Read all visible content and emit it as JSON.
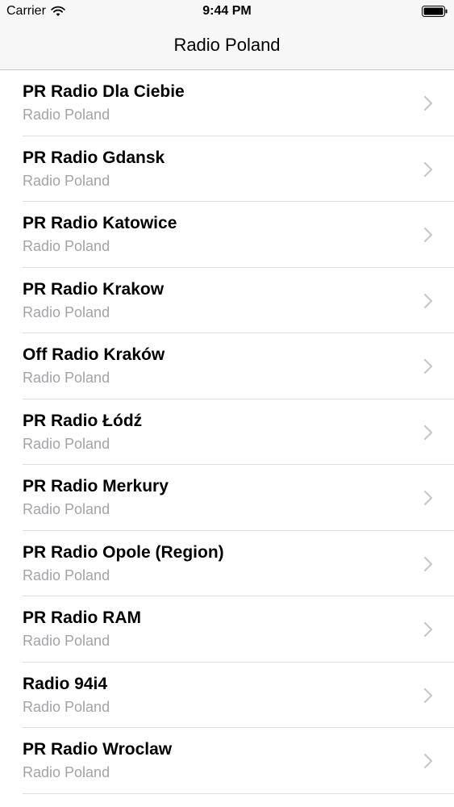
{
  "status_bar": {
    "carrier": "Carrier",
    "time": "9:44 PM",
    "icons": [
      "wifi-icon",
      "battery-icon"
    ]
  },
  "nav": {
    "title": "Radio Poland"
  },
  "stations": [
    {
      "name": "PR Radio Dla Ciebie",
      "subtitle": "Radio Poland"
    },
    {
      "name": "PR Radio Gdansk",
      "subtitle": "Radio Poland"
    },
    {
      "name": "PR Radio Katowice",
      "subtitle": "Radio Poland"
    },
    {
      "name": "PR Radio Krakow",
      "subtitle": "Radio Poland"
    },
    {
      "name": "Off Radio Kraków",
      "subtitle": "Radio Poland"
    },
    {
      "name": "PR Radio Łódź",
      "subtitle": "Radio Poland"
    },
    {
      "name": "PR Radio Merkury",
      "subtitle": "Radio Poland"
    },
    {
      "name": "PR Radio Opole (Region)",
      "subtitle": "Radio Poland"
    },
    {
      "name": "PR Radio RAM",
      "subtitle": "Radio Poland"
    },
    {
      "name": "Radio 94i4",
      "subtitle": "Radio Poland"
    },
    {
      "name": "PR Radio Wroclaw",
      "subtitle": "Radio Poland"
    }
  ],
  "colors": {
    "nav_background": "#f7f7f7",
    "subtitle": "#a3a3a8",
    "separator": "#e0e0e4",
    "chevron": "#c7c7cc"
  }
}
